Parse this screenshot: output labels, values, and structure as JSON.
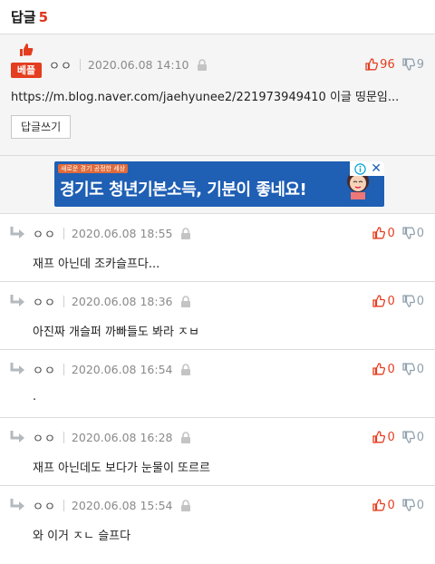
{
  "header": {
    "title": "답글",
    "count": "5"
  },
  "best_comment": {
    "badge": "베플",
    "nick": "ㅇㅇ",
    "date": "2020.06.08 14:10",
    "upvotes": "96",
    "downvotes": "9",
    "body": "https://m.blog.naver.com/jaehyunee2/221973949410 이글 띵문임...",
    "reply_button": "답글쓰기"
  },
  "ad": {
    "tag": "새로운 경기 공정한 세상",
    "text": "경기도 청년기본소득, 기분이 좋네요!",
    "close": "✕"
  },
  "replies": [
    {
      "nick": "ㅇㅇ",
      "date": "2020.06.08 18:55",
      "up": "0",
      "down": "0",
      "body": "재프 아닌데 조카슬프다..."
    },
    {
      "nick": "ㅇㅇ",
      "date": "2020.06.08 18:36",
      "up": "0",
      "down": "0",
      "body": "아진짜 개슬퍼 까빠들도 봐라 ㅈㅂ"
    },
    {
      "nick": "ㅇㅇ",
      "date": "2020.06.08 16:54",
      "up": "0",
      "down": "0",
      "body": "."
    },
    {
      "nick": "ㅇㅇ",
      "date": "2020.06.08 16:28",
      "up": "0",
      "down": "0",
      "body": "재프 아닌데도 보다가 눈물이 또르르"
    },
    {
      "nick": "ㅇㅇ",
      "date": "2020.06.08 15:54",
      "up": "0",
      "down": "0",
      "body": "와 이거 ㅈㄴ 슬프다"
    }
  ],
  "colors": {
    "accent": "#e43d1f",
    "down": "#8fa0ad",
    "ad_bg": "#1f5fb4"
  }
}
